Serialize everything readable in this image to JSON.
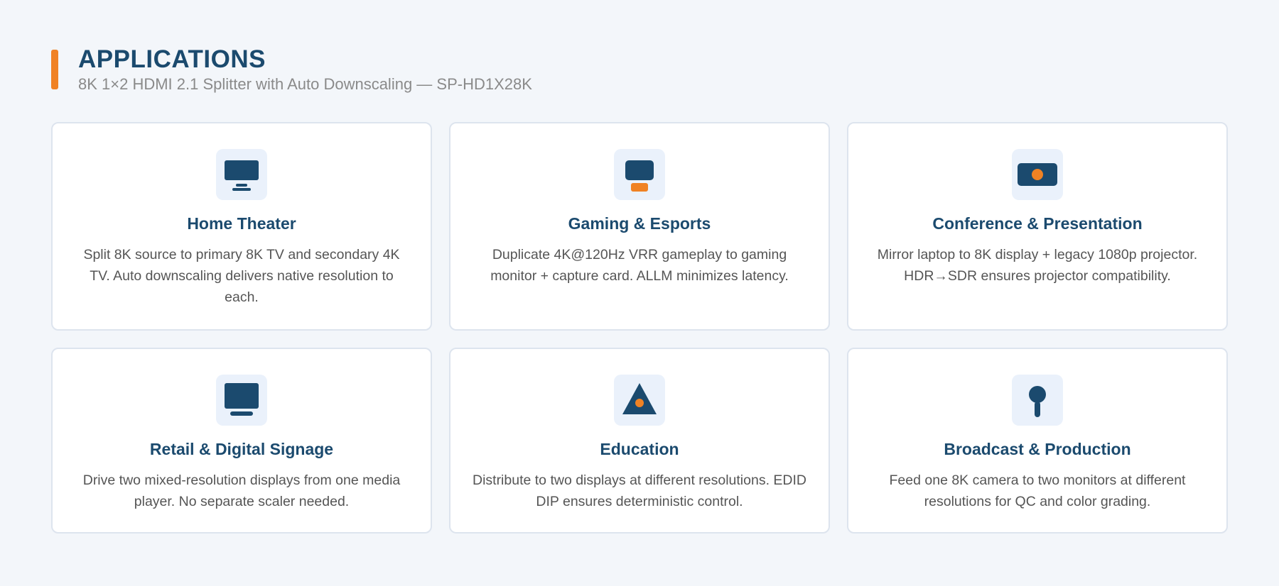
{
  "header": {
    "title": "APPLICATIONS",
    "subtitle": "8K 1×2 HDMI 2.1 Splitter with Auto Downscaling — SP-HD1X28K"
  },
  "colors": {
    "primary": "#1b4a6e",
    "accent": "#f08224"
  },
  "cards": [
    {
      "icon": "tv-icon",
      "title": "Home Theater",
      "description": "Split 8K source to primary 8K TV and secondary 4K TV. Auto downscaling delivers native resolution to each."
    },
    {
      "icon": "game-console-icon",
      "title": "Gaming & Esports",
      "description": "Duplicate 4K@120Hz VRR gameplay to gaming monitor + capture card. ALLM minimizes latency."
    },
    {
      "icon": "projector-icon",
      "title": "Conference & Presentation",
      "description": "Mirror laptop to 8K display + legacy 1080p projector. HDR→SDR ensures projector compatibility."
    },
    {
      "icon": "signage-display-icon",
      "title": "Retail & Digital Signage",
      "description": "Drive two mixed-resolution displays from one media player. No separate scaler needed."
    },
    {
      "icon": "education-icon",
      "title": "Education",
      "description": "Distribute to two displays at different resolutions. EDID DIP ensures deterministic control."
    },
    {
      "icon": "microphone-icon",
      "title": "Broadcast & Production",
      "description": "Feed one 8K camera to two monitors at different resolutions for QC and color grading."
    }
  ]
}
